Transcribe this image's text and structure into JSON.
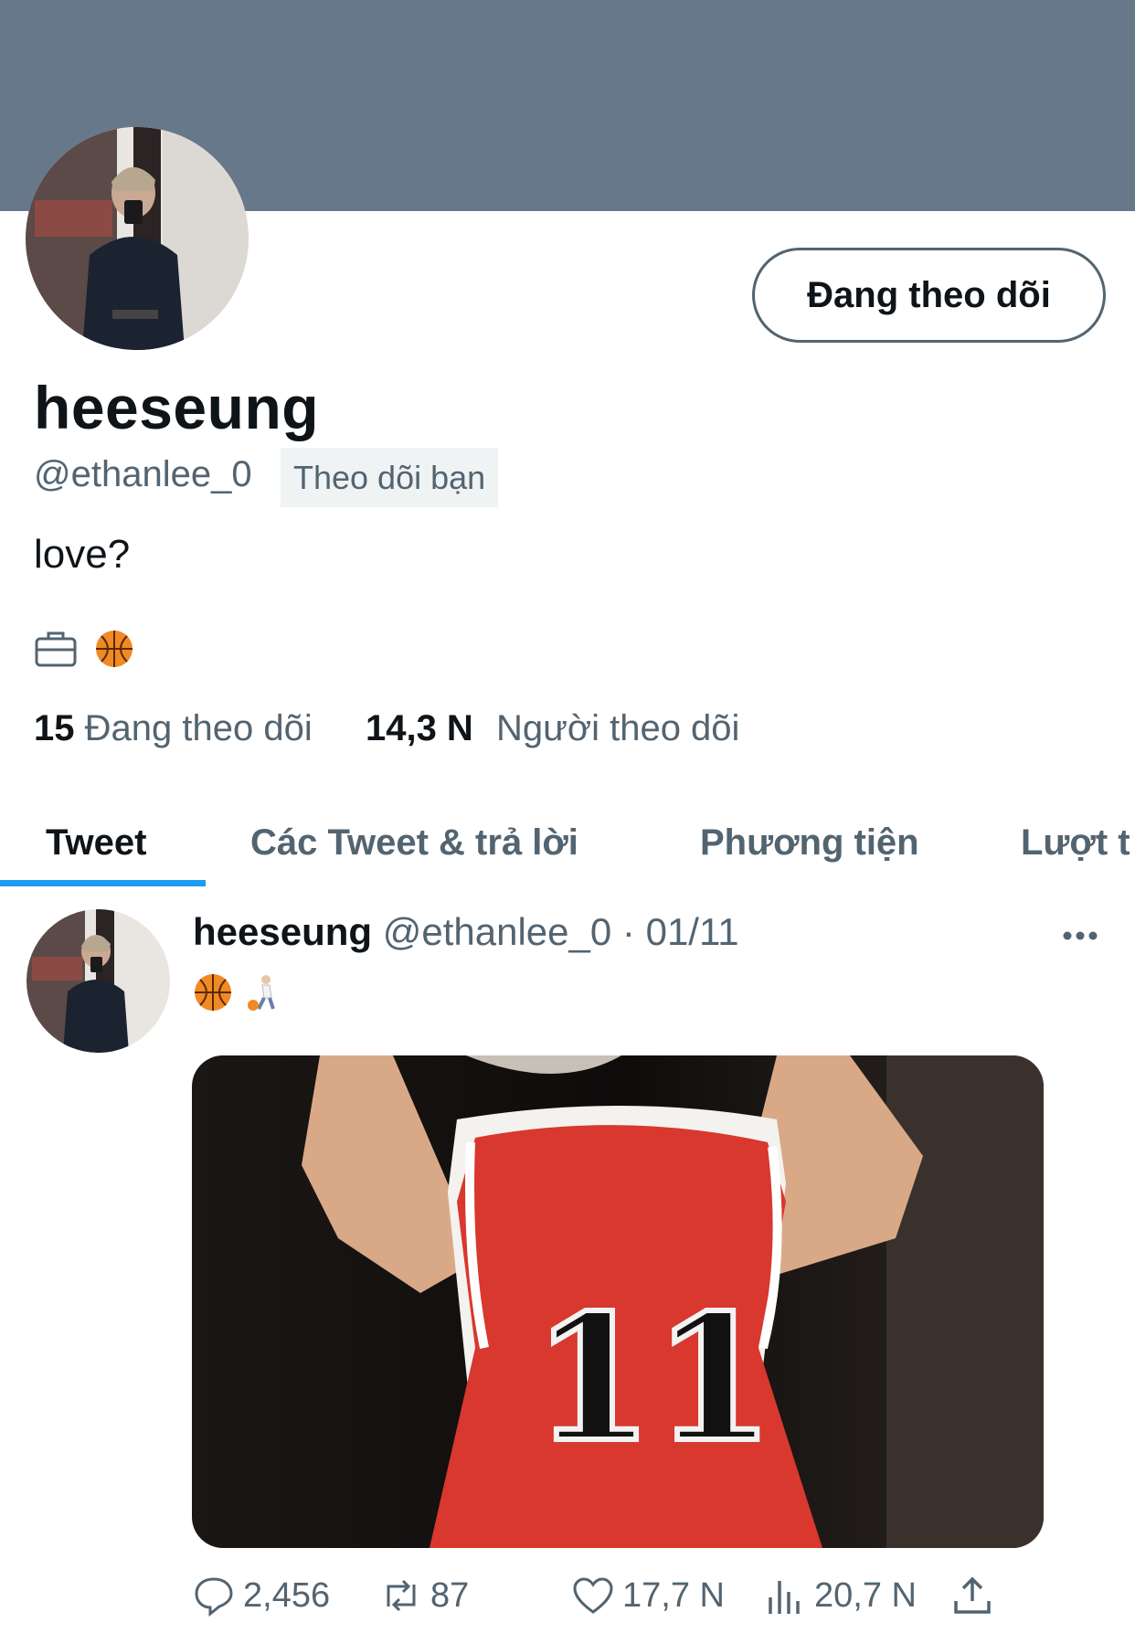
{
  "profile": {
    "name": "heeseung",
    "handle": "@ethanlee_0",
    "follows_you": "Theo dõi bạn",
    "bio": "love?",
    "follow_button": "Đang theo dõi",
    "following_count": "15",
    "following_label": "Đang theo dõi",
    "followers_count": "14,3 N",
    "followers_label": "Người theo dõi",
    "meta_icons": [
      "briefcase-icon",
      "basketball-emoji"
    ]
  },
  "tabs": [
    {
      "label": "Tweet",
      "active": true
    },
    {
      "label": "Các Tweet & trả lời",
      "active": false
    },
    {
      "label": "Phương tiện",
      "active": false
    },
    {
      "label": "Lượt t",
      "active": false
    }
  ],
  "tweet": {
    "name": "heeseung",
    "handle": "@ethanlee_0",
    "separator": "·",
    "date": "01/11",
    "emojis": [
      "basketball-emoji",
      "person-bouncing-ball-emoji"
    ],
    "media_jersey_number": "11",
    "replies": "2,456",
    "retweets": "87",
    "likes": "17,7 N",
    "views": "20,7 N"
  },
  "colors": {
    "banner": "#66788a",
    "accent": "#1d9bf0",
    "secondary_text": "#536471",
    "jersey_red": "#d8382e"
  }
}
